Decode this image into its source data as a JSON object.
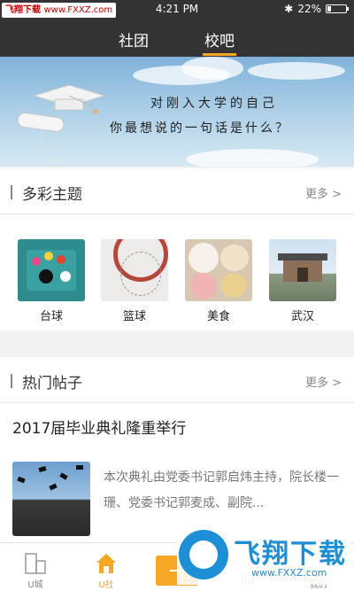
{
  "status": {
    "watermark_brand": "飞翔下载",
    "watermark_url": "www.FXXZ.com",
    "time": "4:21 PM",
    "battery": "22%",
    "battery_level": 0.22
  },
  "topnav": {
    "tabs": [
      {
        "label": "社团"
      },
      {
        "label": "校吧"
      }
    ],
    "active_index": 1,
    "accent": "#f5a623"
  },
  "banner": {
    "line1": "对刚入大学的自己",
    "line2": "你最想说的一句话是什么？"
  },
  "themes": {
    "title": "多彩主题",
    "more": "更多 >",
    "items": [
      {
        "label": "台球"
      },
      {
        "label": "篮球"
      },
      {
        "label": "美食"
      },
      {
        "label": "武汉"
      }
    ]
  },
  "posts": {
    "title": "热门帖子",
    "more": "更多 >",
    "items": [
      {
        "title": "2017届毕业典礼隆重举行",
        "desc": "本次典礼由党委书记郭启炜主持，院长楼一珊、党委书记郭麦成、副院..."
      }
    ]
  },
  "tabbar": {
    "items": [
      {
        "label": "U城"
      },
      {
        "label": "U社"
      },
      {
        "label": "UU"
      },
      {
        "label": "我的"
      }
    ],
    "active_index": 1
  },
  "watermark2": {
    "brand": "飞翔下载",
    "url": "www.FXXZ.com"
  }
}
